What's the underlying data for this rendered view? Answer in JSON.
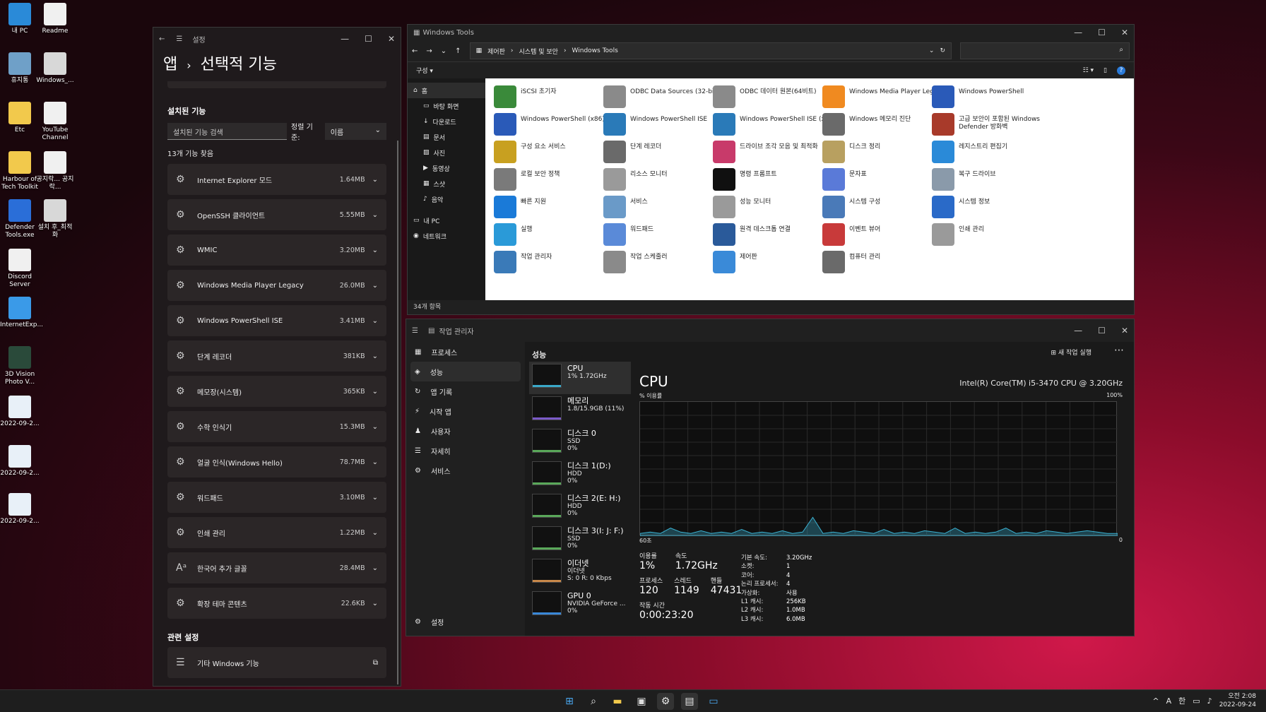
{
  "desktop": {
    "icons": [
      {
        "label": "내 PC",
        "color": "#2a8ad8"
      },
      {
        "label": "Readme",
        "color": "#f0f0f0"
      },
      {
        "label": "휴지통",
        "color": "#6fa0c8"
      },
      {
        "label": "Windows_...",
        "color": "#d8d8d8"
      },
      {
        "label": "Etc",
        "color": "#f2c94c"
      },
      {
        "label": "YouTube Channel",
        "color": "#f0f0f0"
      },
      {
        "label": "Harbour of Tech Toolkit",
        "color": "#f2c94c"
      },
      {
        "label": "공지락... 공지락...",
        "color": "#f0f0f0"
      },
      {
        "label": "Defender Tools.exe",
        "color": "#2a6ed8"
      },
      {
        "label": "설치 후_최적화",
        "color": "#d8d8d8"
      },
      {
        "label": "Discord Server",
        "color": "#f0f0f0"
      },
      {
        "label": "InternetExp...",
        "color": "#3a9ae8"
      },
      {
        "label": "3D Vision Photo V...",
        "color": "#2a4a3a"
      },
      {
        "label": "2022-09-2...",
        "color": "#e8f0f8"
      },
      {
        "label": "2022-09-2...",
        "color": "#e8f0f8"
      },
      {
        "label": "2022-09-2...",
        "color": "#e8f0f8"
      }
    ]
  },
  "settings": {
    "window_title": "설정",
    "breadcrumb_parent": "앱",
    "breadcrumb_sep": "›",
    "page_title": "선택적 기능",
    "installed_heading": "설치된 기능",
    "search_placeholder": "설치된 기능 검색",
    "sort_label": "정렬 기준:",
    "sort_value": "이름",
    "found_count": "13개 기능 찾음",
    "features": [
      {
        "name": "Internet Explorer 모드",
        "size": "1.64MB"
      },
      {
        "name": "OpenSSH 클라이언트",
        "size": "5.55MB"
      },
      {
        "name": "WMIC",
        "size": "3.20MB"
      },
      {
        "name": "Windows Media Player Legacy",
        "size": "26.0MB"
      },
      {
        "name": "Windows PowerShell ISE",
        "size": "3.41MB"
      },
      {
        "name": "단계 레코더",
        "size": "381KB"
      },
      {
        "name": "메모장(시스템)",
        "size": "365KB"
      },
      {
        "name": "수학 인식기",
        "size": "15.3MB"
      },
      {
        "name": "얼굴 인식(Windows Hello)",
        "size": "78.7MB"
      },
      {
        "name": "워드패드",
        "size": "3.10MB"
      },
      {
        "name": "인쇄 관리",
        "size": "1.22MB"
      },
      {
        "name": "한국어 추가 글꼴",
        "size": "28.4MB"
      },
      {
        "name": "확장 테마 콘텐츠",
        "size": "22.6KB"
      }
    ],
    "related_heading": "관련 설정",
    "related_item": "기타 Windows 기능"
  },
  "explorer": {
    "window_title": "Windows Tools",
    "path": [
      "제어판",
      "시스템 및 보안",
      "Windows Tools"
    ],
    "organize": "구성 ▾",
    "nav": [
      {
        "label": "홈"
      },
      {
        "label": "바탕 화면"
      },
      {
        "label": "다운로드"
      },
      {
        "label": "문서"
      },
      {
        "label": "사진"
      },
      {
        "label": "동영상"
      },
      {
        "label": "스샷"
      },
      {
        "label": "음악"
      },
      {
        "label": "내 PC"
      },
      {
        "label": "네트워크"
      }
    ],
    "tools": [
      {
        "name": "iSCSI 초기자",
        "color": "#3a8a3a"
      },
      {
        "name": "ODBC Data Sources (32-bit)",
        "color": "#8a8a8a"
      },
      {
        "name": "ODBC 데이터 원본(64비트)",
        "color": "#8a8a8a"
      },
      {
        "name": "Windows Media Player Legacy",
        "color": "#f08a20"
      },
      {
        "name": "Windows PowerShell",
        "color": "#2a5ab8"
      },
      {
        "name": "Windows PowerShell (x86)",
        "color": "#2a5ab8"
      },
      {
        "name": "Windows PowerShell ISE",
        "color": "#2a7ab8"
      },
      {
        "name": "Windows PowerShell ISE (x86)",
        "color": "#2a7ab8"
      },
      {
        "name": "Windows 메모리 진단",
        "color": "#6a6a6a"
      },
      {
        "name": "고급 보안이 포함된 Windows Defender 방화벽",
        "color": "#a83a2a"
      },
      {
        "name": "구성 요소 서비스",
        "color": "#c8a020"
      },
      {
        "name": "단계 레코더",
        "color": "#6a6a6a"
      },
      {
        "name": "드라이브 조각 모음 및 최적화",
        "color": "#c83a6a"
      },
      {
        "name": "디스크 정리",
        "color": "#b8a060"
      },
      {
        "name": "레지스트리 편집기",
        "color": "#2a8ad8"
      },
      {
        "name": "로컬 보안 정책",
        "color": "#7a7a7a"
      },
      {
        "name": "리소스 모니터",
        "color": "#9a9a9a"
      },
      {
        "name": "명령 프롬프트",
        "color": "#101010"
      },
      {
        "name": "문자표",
        "color": "#5a7ad8"
      },
      {
        "name": "복구 드라이브",
        "color": "#8a9aaa"
      },
      {
        "name": "빠른 지원",
        "color": "#1a7ad8"
      },
      {
        "name": "서비스",
        "color": "#6a9ac8"
      },
      {
        "name": "성능 모니터",
        "color": "#9a9a9a"
      },
      {
        "name": "시스템 구성",
        "color": "#4a7ab8"
      },
      {
        "name": "시스템 정보",
        "color": "#2a6ac8"
      },
      {
        "name": "실행",
        "color": "#2a9ad8"
      },
      {
        "name": "워드패드",
        "color": "#5a8ad8"
      },
      {
        "name": "원격 데스크톱 연결",
        "color": "#2a5a9a"
      },
      {
        "name": "이벤트 뷰어",
        "color": "#c83a3a"
      },
      {
        "name": "인쇄 관리",
        "color": "#9a9a9a"
      },
      {
        "name": "작업 관리자",
        "color": "#3a7ab8"
      },
      {
        "name": "작업 스케줄러",
        "color": "#8a8a8a"
      },
      {
        "name": "제어판",
        "color": "#3a8ad8"
      },
      {
        "name": "컴퓨터 관리",
        "color": "#6a6a6a"
      }
    ],
    "status": "34개 항목"
  },
  "taskmgr": {
    "window_title": "작업 관리자",
    "nav": [
      {
        "label": "프로세스"
      },
      {
        "label": "성능"
      },
      {
        "label": "앱 기록"
      },
      {
        "label": "시작 앱"
      },
      {
        "label": "사용자"
      },
      {
        "label": "자세히"
      },
      {
        "label": "서비스"
      }
    ],
    "settings_label": "설정",
    "section_title": "성능",
    "new_task": "새 작업 실행",
    "perf_items": [
      {
        "title": "CPU",
        "l1": "1% 1.72GHz",
        "l2": ""
      },
      {
        "title": "메모리",
        "l1": "1.8/15.9GB (11%)",
        "l2": ""
      },
      {
        "title": "디스크 0",
        "l1": "SSD",
        "l2": "0%"
      },
      {
        "title": "디스크 1(D:)",
        "l1": "HDD",
        "l2": "0%"
      },
      {
        "title": "디스크 2(E: H:)",
        "l1": "HDD",
        "l2": "0%"
      },
      {
        "title": "디스크 3(I: J: F:)",
        "l1": "SSD",
        "l2": "0%"
      },
      {
        "title": "이더넷",
        "l1": "이더넷",
        "l2": "S: 0 R: 0 Kbps"
      },
      {
        "title": "GPU 0",
        "l1": "NVIDIA GeForce ...",
        "l2": "0%"
      }
    ],
    "cpu_title": "CPU",
    "cpu_model": "Intel(R) Core(TM) i5-3470 CPU @ 3.20GHz",
    "usage_label": "% 이용률",
    "max_label": "100%",
    "time_label": "60초",
    "min_label": "0",
    "cpu_history": [
      2,
      3,
      2,
      6,
      3,
      2,
      4,
      2,
      3,
      2,
      5,
      2,
      3,
      2,
      4,
      2,
      3,
      14,
      2,
      3,
      2,
      4,
      3,
      2,
      5,
      2,
      3,
      2,
      4,
      3,
      2,
      6,
      2,
      3,
      2,
      3,
      6,
      2,
      3,
      2,
      4,
      3,
      2,
      3,
      4,
      3,
      2,
      2
    ],
    "stats": {
      "util_label": "이용률",
      "util": "1%",
      "speed_label": "속도",
      "speed": "1.72GHz",
      "proc_label": "프로세스",
      "proc": "120",
      "thread_label": "스레드",
      "thread": "1149",
      "handle_label": "핸들",
      "handle": "47431",
      "uptime_label": "작동 시간",
      "uptime": "0:00:23:20"
    },
    "specs": [
      {
        "k": "기본 속도:",
        "v": "3.20GHz"
      },
      {
        "k": "소켓:",
        "v": "1"
      },
      {
        "k": "코어:",
        "v": "4"
      },
      {
        "k": "논리 프로세서:",
        "v": "4"
      },
      {
        "k": "가상화:",
        "v": "사용"
      },
      {
        "k": "L1 캐시:",
        "v": "256KB"
      },
      {
        "k": "L2 캐시:",
        "v": "1.0MB"
      },
      {
        "k": "L3 캐시:",
        "v": "6.0MB"
      }
    ]
  },
  "taskbar": {
    "time": "오전 2:08",
    "date": "2022-09-24",
    "ime1": "A",
    "ime2": "한"
  }
}
